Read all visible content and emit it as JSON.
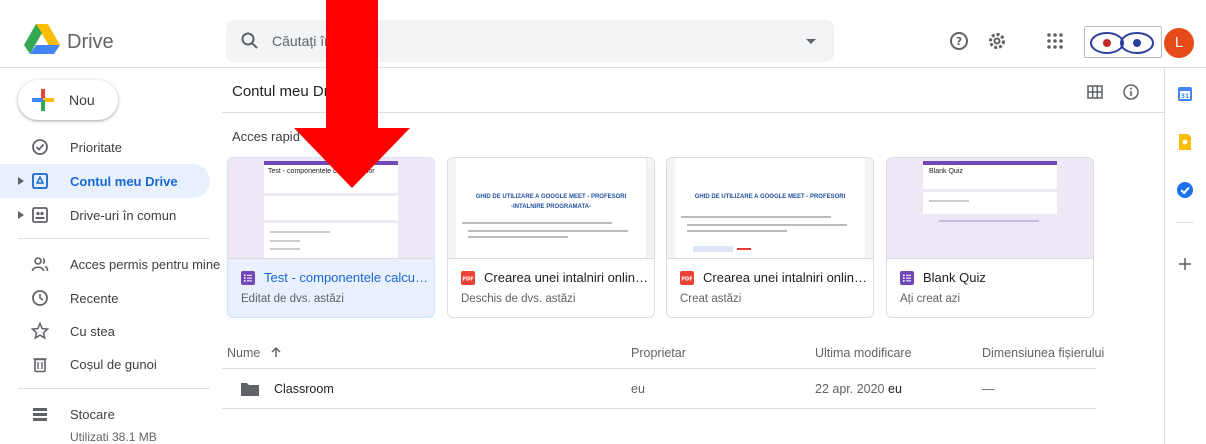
{
  "app": {
    "name": "Drive"
  },
  "search": {
    "placeholder": "Căutați în Drive"
  },
  "user": {
    "avatar_letter": "L"
  },
  "new_button": {
    "label": "Nou"
  },
  "sidebar": {
    "items": [
      {
        "label": "Prioritate",
        "icon": "check-circle-icon"
      },
      {
        "label": "Contul meu Drive",
        "icon": "my-drive-icon",
        "active": true
      },
      {
        "label": "Drive-uri în comun",
        "icon": "shared-drives-icon"
      },
      {
        "label": "Acces permis pentru mine",
        "icon": "shared-with-me-icon"
      },
      {
        "label": "Recente",
        "icon": "clock-icon"
      },
      {
        "label": "Cu stea",
        "icon": "star-icon"
      },
      {
        "label": "Coșul de gunoi",
        "icon": "trash-icon"
      }
    ],
    "storage": {
      "label": "Stocare",
      "used": "Utilizati 38.1 MB"
    }
  },
  "main": {
    "breadcrumb": "Contul meu Drive",
    "quick_access_title": "Acces rapid",
    "cards": [
      {
        "title": "Test - componentele calculat...",
        "subtitle": "Editat de dvs. astăzi",
        "type": "forms",
        "selected": true,
        "thumb_title": "Test - componentele calculatorelor"
      },
      {
        "title": "Crearea unei intalniri online pr...",
        "subtitle": "Deschis de dvs. astăzi",
        "type": "pdf",
        "thumb_title": "GHID DE UTILIZARE A GOOGLE MEET - PROFESORI",
        "thumb_sub": "-INTALNIRE PROGRAMATA-"
      },
      {
        "title": "Crearea unei intalniri online c...",
        "subtitle": "Creat astăzi",
        "type": "pdf",
        "thumb_title": "GHID DE UTILIZARE A GOOGLE MEET - PROFESORI"
      },
      {
        "title": "Blank Quiz",
        "subtitle": "Ați creat azi",
        "type": "forms",
        "thumb_title": "Blank Quiz"
      }
    ],
    "table": {
      "headers": {
        "name": "Nume",
        "owner": "Proprietar",
        "modified": "Ultima modificare",
        "size": "Dimensiunea fișierului"
      },
      "rows": [
        {
          "name": "Classroom",
          "owner": "eu",
          "modified_date": "22 apr. 2020",
          "modified_by": "eu",
          "size": "—"
        }
      ]
    }
  },
  "colors": {
    "accent": "#1967d2",
    "active_bg": "#e8f0fe",
    "forms_purple": "#7248b9",
    "pdf_red": "#ea4335",
    "arrow_red": "#ff0000"
  }
}
